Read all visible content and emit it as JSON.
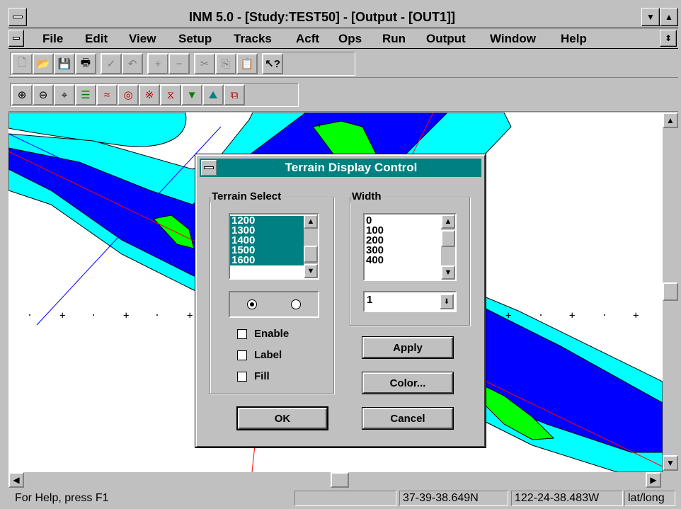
{
  "window": {
    "title": "INM 5.0 - [Study:TEST50] - [Output - [OUT1]]"
  },
  "menu": [
    {
      "label": "File"
    },
    {
      "label": "Edit"
    },
    {
      "label": "View"
    },
    {
      "label": "Setup"
    },
    {
      "label": "Tracks"
    },
    {
      "label": "Acft"
    },
    {
      "label": "Ops"
    },
    {
      "label": "Run"
    },
    {
      "label": "Output"
    },
    {
      "label": "Window"
    },
    {
      "label": "Help"
    }
  ],
  "toolbar1": [
    "new-file-icon",
    "open-folder-icon",
    "save-disk-icon",
    "print-icon",
    "check-icon",
    "undo-icon",
    "add-icon",
    "remove-icon",
    "cut-icon",
    "copy-icon",
    "paste-icon",
    "context-help-icon"
  ],
  "toolbar2": [
    "zoom-in-icon",
    "zoom-out-icon",
    "center-icon",
    "layers-icon",
    "tracks-icon",
    "contour-icon",
    "grid-points-icon",
    "runway-icon",
    "locations-icon",
    "terrain-icon",
    "overlay-icon"
  ],
  "dialog": {
    "title": "Terrain Display Control",
    "terrain_select_label": "Terrain Select",
    "terrain_items": [
      "1200",
      "1300",
      "1400",
      "1500",
      "1600"
    ],
    "width_label": "Width",
    "width_items": [
      "0",
      "100",
      "200",
      "300",
      "400"
    ],
    "width_combo_value": "1",
    "enable_label": "Enable",
    "label_label": "Label",
    "fill_label": "Fill",
    "apply_label": "Apply",
    "color_label": "Color...",
    "ok_label": "OK",
    "cancel_label": "Cancel"
  },
  "status": {
    "help": "For Help, press F1",
    "lat": "37-39-38.649N",
    "lon": "122-24-38.483W",
    "mode": "lat/long"
  },
  "colors": {
    "cyan": "#00ffff",
    "blue": "#0000ff",
    "green": "#00ff00",
    "teal": "#008080",
    "track": "#ff0000"
  }
}
